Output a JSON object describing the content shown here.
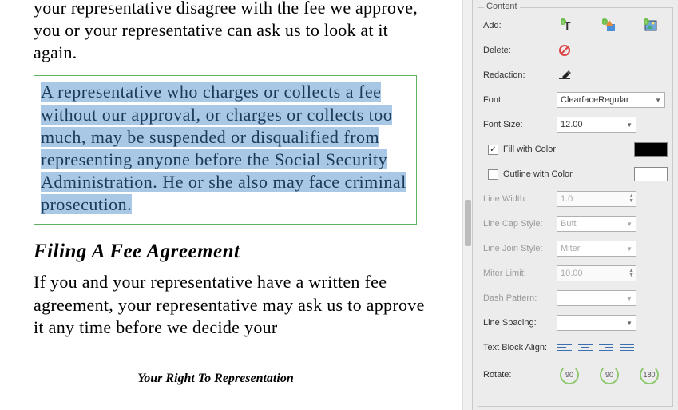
{
  "document": {
    "para_top": "your representative disagree with the fee we approve, you or your representative can ask us to look at it again.",
    "selected_text": "A representative who charges or collects a fee without our approval, or charges or collects too much, may be suspended or disqualified from representing anyone before the Social Security Administration. He or she also may face criminal prosecution.",
    "heading": "Filing A Fee Agreement",
    "para_bottom": "If you and your representative have a written fee agreement, your representative may ask us to approve it any time before we decide your",
    "footer": "Your Right To Representation"
  },
  "panel": {
    "title": "Content",
    "add_label": "Add:",
    "delete_label": "Delete:",
    "redaction_label": "Redaction:",
    "font_label": "Font:",
    "font_value": "ClearfaceRegular",
    "fontsize_label": "Font Size:",
    "fontsize_value": "12.00",
    "fill_label": "Fill with Color",
    "outline_label": "Outline with Color",
    "linewidth_label": "Line Width:",
    "linewidth_value": "1.0",
    "linecap_label": "Line Cap Style:",
    "linecap_value": "Butt",
    "linejoin_label": "Line Join Style:",
    "linejoin_value": "Miter",
    "miter_label": "Miter Limit:",
    "miter_value": "10.00",
    "dash_label": "Dash Pattern:",
    "dash_value": "",
    "linespacing_label": "Line Spacing:",
    "linespacing_value": "",
    "align_label": "Text Block Align:",
    "rotate_label": "Rotate:",
    "rot90a": "90",
    "rot90b": "90",
    "rot180": "180"
  }
}
